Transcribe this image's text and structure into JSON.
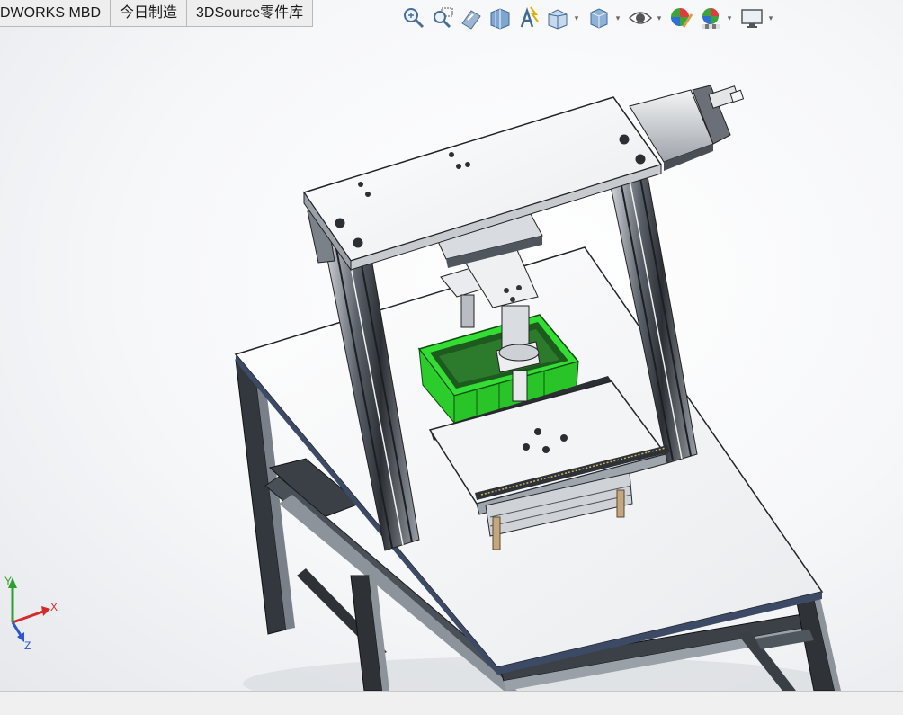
{
  "tabs": [
    {
      "label": "DWORKS MBD"
    },
    {
      "label": "今日制造"
    },
    {
      "label": "3DSource零件库"
    }
  ],
  "toolbar": {
    "icons": [
      "zoom-to-fit-icon",
      "zoom-to-area-icon",
      "previous-view-icon",
      "section-view-icon",
      "dynamic-annotation-icon",
      "view-orientation-icon",
      "display-style-icon",
      "hide-show-items-icon",
      "edit-appearance-icon",
      "apply-scene-icon",
      "view-settings-icon"
    ]
  },
  "triad": {
    "x_label": "X",
    "y_label": "Y",
    "z_label": "Z"
  },
  "colors": {
    "bin_green": "#33dd33",
    "frame_dark": "#3a3f45",
    "plate_light": "#f2f2f2",
    "x_axis": "#d42a2a",
    "y_axis": "#2ea02e",
    "z_axis": "#2a55d4"
  }
}
